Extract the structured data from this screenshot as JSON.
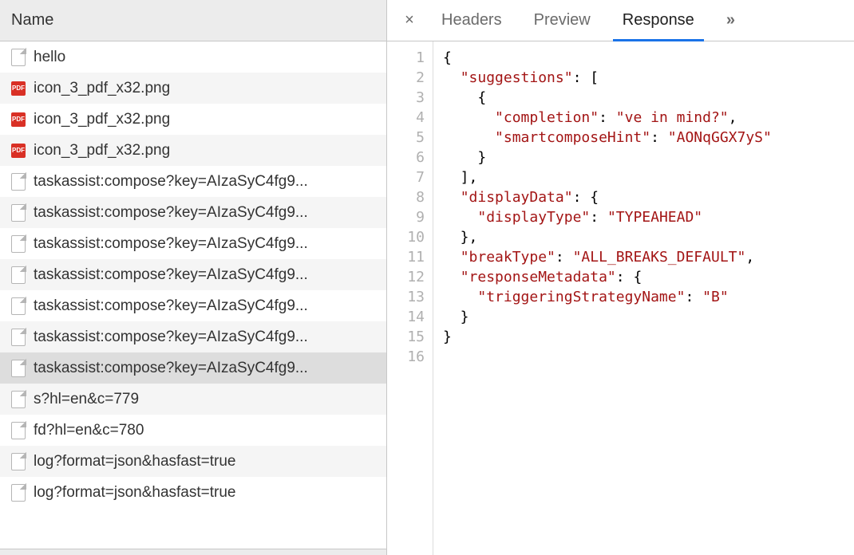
{
  "left": {
    "header": "Name",
    "items": [
      {
        "label": "hello",
        "icon": "doc",
        "selected": false
      },
      {
        "label": "icon_3_pdf_x32.png",
        "icon": "pdf",
        "selected": false
      },
      {
        "label": "icon_3_pdf_x32.png",
        "icon": "pdf",
        "selected": false
      },
      {
        "label": "icon_3_pdf_x32.png",
        "icon": "pdf",
        "selected": false
      },
      {
        "label": "taskassist:compose?key=AIzaSyC4fg9...",
        "icon": "doc",
        "selected": false
      },
      {
        "label": "taskassist:compose?key=AIzaSyC4fg9...",
        "icon": "doc",
        "selected": false
      },
      {
        "label": "taskassist:compose?key=AIzaSyC4fg9...",
        "icon": "doc",
        "selected": false
      },
      {
        "label": "taskassist:compose?key=AIzaSyC4fg9...",
        "icon": "doc",
        "selected": false
      },
      {
        "label": "taskassist:compose?key=AIzaSyC4fg9...",
        "icon": "doc",
        "selected": false
      },
      {
        "label": "taskassist:compose?key=AIzaSyC4fg9...",
        "icon": "doc",
        "selected": false
      },
      {
        "label": "taskassist:compose?key=AIzaSyC4fg9...",
        "icon": "doc",
        "selected": true
      },
      {
        "label": "s?hl=en&c=779",
        "icon": "doc",
        "selected": false
      },
      {
        "label": "fd?hl=en&c=780",
        "icon": "doc",
        "selected": false
      },
      {
        "label": "log?format=json&hasfast=true",
        "icon": "doc",
        "selected": false
      },
      {
        "label": "log?format=json&hasfast=true",
        "icon": "doc",
        "selected": false
      }
    ]
  },
  "tabs": {
    "close": "×",
    "items": [
      {
        "label": "Headers",
        "active": false
      },
      {
        "label": "Preview",
        "active": false
      },
      {
        "label": "Response",
        "active": true
      }
    ],
    "more": "»"
  },
  "response": {
    "suggestions": [
      {
        "completion": "ve in mind?",
        "smartcomposeHint": "AONqGGX7yS"
      }
    ],
    "displayData": {
      "displayType": "TYPEAHEAD"
    },
    "breakType": "ALL_BREAKS_DEFAULT",
    "responseMetadata": {
      "triggeringStrategyName": "B"
    },
    "lineCount": 16
  }
}
